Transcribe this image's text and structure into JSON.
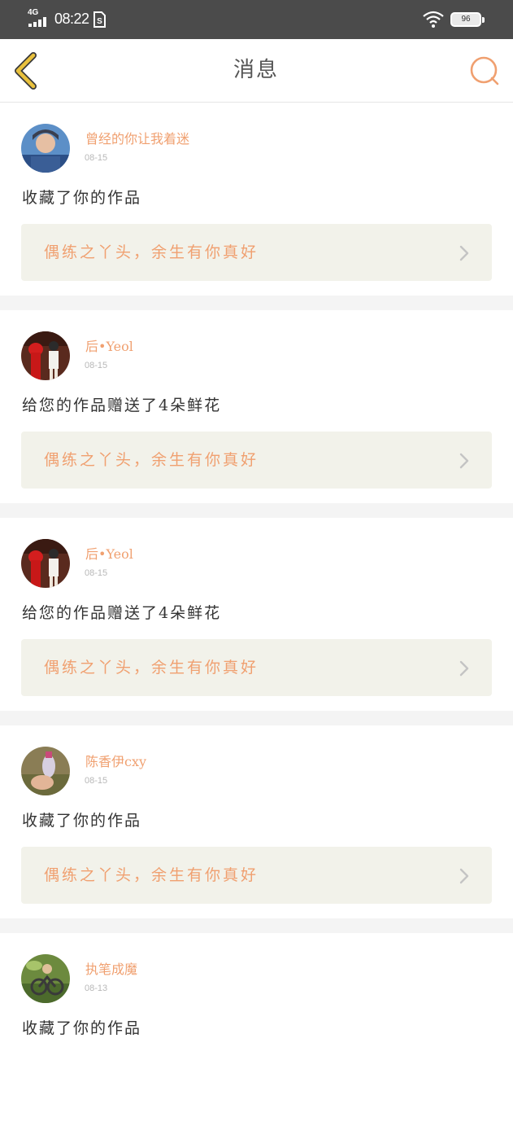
{
  "status_bar": {
    "network": "4G",
    "time": "08:22",
    "battery": "96"
  },
  "header": {
    "title": "消息",
    "back_icon": "chevron-left-icon",
    "search_icon": "search-icon"
  },
  "messages": [
    {
      "username": "曾经的你让我着迷",
      "date": "08-15",
      "action": "收藏了你的作品",
      "work_title": "偶练之丫头，余生有你真好"
    },
    {
      "username": "后•Yeol",
      "date": "08-15",
      "action": "给您的作品赠送了4朵鲜花",
      "work_title": "偶练之丫头，余生有你真好"
    },
    {
      "username": "后•Yeol",
      "date": "08-15",
      "action": "给您的作品赠送了4朵鲜花",
      "work_title": "偶练之丫头，余生有你真好"
    },
    {
      "username": "陈香伊cxy",
      "date": "08-15",
      "action": "收藏了你的作品",
      "work_title": "偶练之丫头，余生有你真好"
    },
    {
      "username": "执笔成魔",
      "date": "08-13",
      "action": "收藏了你的作品",
      "work_title": ""
    }
  ],
  "colors": {
    "accent": "#f0a070",
    "status_bar_bg": "#4b4b4b",
    "card_bg": "#f2f2ea",
    "divider_bg": "#f4f4f4",
    "back_icon": "#e9c13d"
  }
}
